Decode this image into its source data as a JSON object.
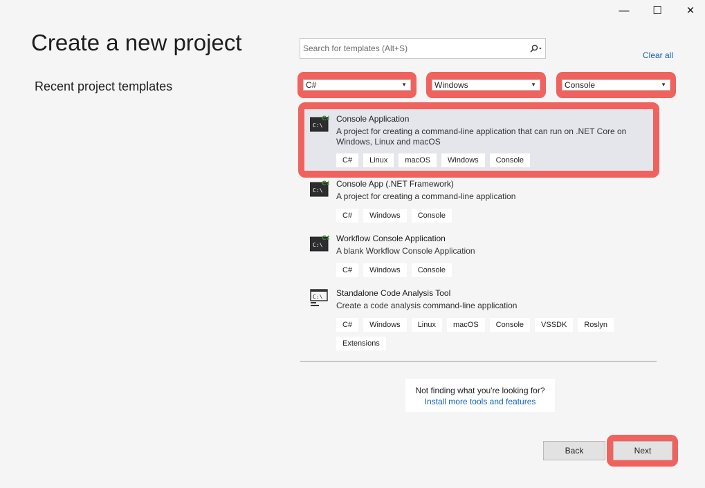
{
  "window": {
    "minimize_glyph": "—",
    "maximize_glyph": "☐",
    "close_glyph": "✕"
  },
  "page": {
    "title": "Create a new project",
    "recent_heading": "Recent project templates"
  },
  "search": {
    "placeholder": "Search for templates (Alt+S)",
    "value": "",
    "icon": "search-icon"
  },
  "clear_all": "Clear all",
  "filters": {
    "language": "C#",
    "platform": "Windows",
    "project_type": "Console"
  },
  "templates": [
    {
      "name": "Console Application",
      "description": "A project for creating a command-line application that can run on .NET Core on Windows, Linux and macOS",
      "tags": [
        "C#",
        "Linux",
        "macOS",
        "Windows",
        "Console"
      ],
      "selected": true,
      "icon": "console-csharp-icon"
    },
    {
      "name": "Console App (.NET Framework)",
      "description": "A project for creating a command-line application",
      "tags": [
        "C#",
        "Windows",
        "Console"
      ],
      "icon": "console-csharp-icon"
    },
    {
      "name": "Workflow Console Application",
      "description": "A blank Workflow Console Application",
      "tags": [
        "C#",
        "Windows",
        "Console"
      ],
      "icon": "console-csharp-icon"
    },
    {
      "name": "Standalone Code Analysis Tool",
      "description": "Create a code analysis command-line application",
      "tags": [
        "C#",
        "Windows",
        "Linux",
        "macOS",
        "Console",
        "VSSDK",
        "Roslyn",
        "Extensions"
      ],
      "icon": "code-analysis-icon"
    }
  ],
  "not_finding": {
    "question": "Not finding what you're looking for?",
    "link": "Install more tools and features"
  },
  "buttons": {
    "back": "Back",
    "next": "Next"
  },
  "colors": {
    "highlight": "#f0625e",
    "link": "#0e60b6",
    "selected_bg": "#e4e6ec"
  }
}
